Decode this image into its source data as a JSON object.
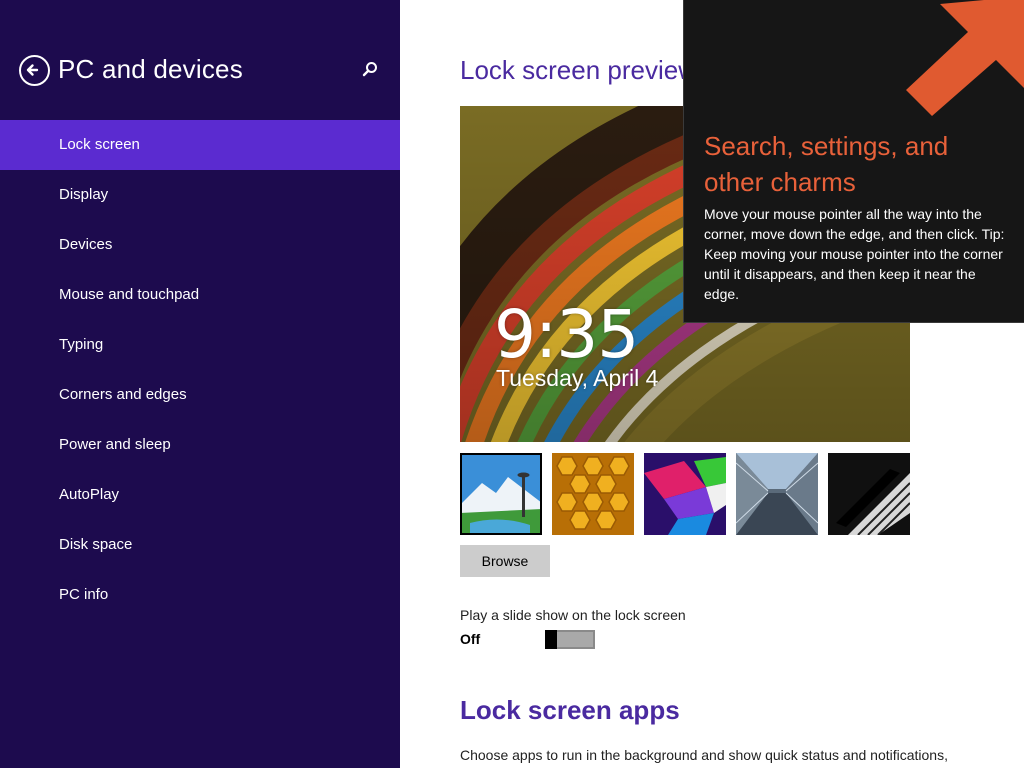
{
  "sidebar": {
    "title": "PC and devices",
    "items": [
      {
        "label": "Lock screen",
        "selected": true
      },
      {
        "label": "Display"
      },
      {
        "label": "Devices"
      },
      {
        "label": "Mouse and touchpad"
      },
      {
        "label": "Typing"
      },
      {
        "label": "Corners and edges"
      },
      {
        "label": "Power and sleep"
      },
      {
        "label": "AutoPlay"
      },
      {
        "label": "Disk space"
      },
      {
        "label": "PC info"
      }
    ]
  },
  "main": {
    "preview_heading": "Lock screen preview",
    "preview_time": "9:35",
    "preview_date": "Tuesday, April 4",
    "thumbnails": [
      {
        "name": "mountain-lake",
        "selected": true
      },
      {
        "name": "honeycomb"
      },
      {
        "name": "colorful-geometry"
      },
      {
        "name": "escalator-tunnel"
      },
      {
        "name": "piano-keys"
      }
    ],
    "browse_label": "Browse",
    "slideshow_label": "Play a slide show on the lock screen",
    "slideshow_state": "Off",
    "apps_heading": "Lock screen apps",
    "apps_description": "Choose apps to run in the background and show quick status and notifications,"
  },
  "charms_tip": {
    "title": "Search, settings, and other charms",
    "body": "Move your mouse pointer all the way into the corner, move down the edge, and then click. Tip: Keep moving your mouse pointer into the corner until it disappears, and then keep it near the edge."
  },
  "colors": {
    "sidebar_bg": "#1d0b4e",
    "selected_item": "#5b2bd0",
    "heading": "#4a2aa0",
    "charm_accent": "#e8613a"
  }
}
